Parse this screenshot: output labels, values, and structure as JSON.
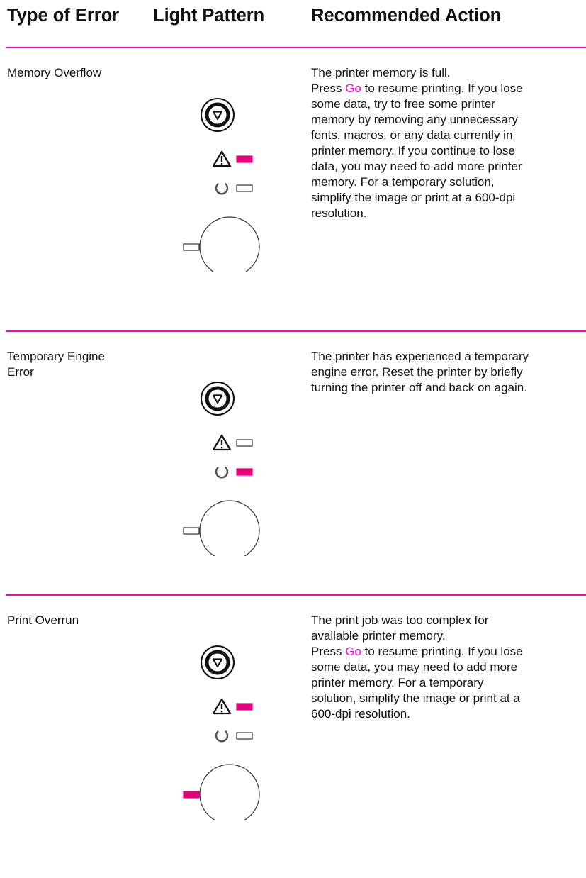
{
  "header": {
    "type_of_error": "Type of Error",
    "light_pattern": "Light Pattern",
    "recommended_action": "Recommended Action"
  },
  "colors": {
    "accent": "#ff00cc",
    "light_on": "#e6007e",
    "outline": "#333333"
  },
  "rows": [
    {
      "type_lines": [
        "Memory Overflow"
      ],
      "action": {
        "lines": [
          [
            "The printer memory is full."
          ],
          [
            "Press ",
            "Go",
            " to resume printing. If you lose"
          ],
          [
            "some data, try to free some printer"
          ],
          [
            "memory by removing any unnecessary"
          ],
          [
            "fonts, macros, or any data currently in"
          ],
          [
            "printer memory. If you continue to lose"
          ],
          [
            "data, you may need to add more printer"
          ],
          [
            "memory. For a temporary solution,"
          ],
          [
            "simplify the image or print at a 600-dpi"
          ],
          [
            "resolution."
          ]
        ]
      },
      "lights": {
        "attention": "on",
        "ready": "off",
        "go": "off"
      }
    },
    {
      "type_lines": [
        "Temporary Engine",
        "Error"
      ],
      "action": {
        "lines": [
          [
            "The printer has experienced a temporary"
          ],
          [
            "engine error. Reset the printer by briefly"
          ],
          [
            "turning the printer off and back on again."
          ]
        ]
      },
      "lights": {
        "attention": "off",
        "ready": "on",
        "go": "off"
      }
    },
    {
      "type_lines": [
        "Print Overrun"
      ],
      "action": {
        "lines": [
          [
            "The print job was too complex for"
          ],
          [
            "available printer memory."
          ],
          [
            "Press ",
            "Go",
            " to resume printing. If you lose"
          ],
          [
            "some data, you may need to add more"
          ],
          [
            "printer memory. For a temporary"
          ],
          [
            "solution, simplify the image or print at a"
          ],
          [
            "600-dpi resolution."
          ]
        ]
      },
      "lights": {
        "attention": "on",
        "ready": "off",
        "go": "on"
      }
    }
  ]
}
